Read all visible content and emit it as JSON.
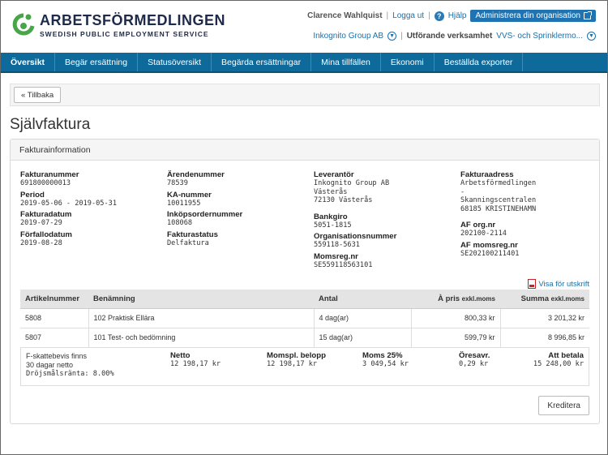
{
  "logo": {
    "title": "ARBETSFÖRMEDLINGEN",
    "subtitle": "SWEDISH PUBLIC EMPLOYMENT SERVICE",
    "icon": "af-logo-icon",
    "color": "#4aa54a"
  },
  "user": {
    "name": "Clarence Wahlquist",
    "separator": "|",
    "logout": "Logga ut",
    "help": "Hjälp",
    "help_icon": "?",
    "admin_button": "Administrera din organisation"
  },
  "org": {
    "name": "Inkognito Group AB",
    "separator": "|",
    "activity_label": "Utförande verksamhet",
    "activity_value": "VVS- och Sprinklermo..."
  },
  "nav": {
    "items": [
      "Översikt",
      "Begär ersättning",
      "Statusöversikt",
      "Begärda ersättningar",
      "Mina tillfällen",
      "Ekonomi",
      "Beställda exporter"
    ],
    "active": 0
  },
  "back_button": "« Tillbaka",
  "page_title": "Självfaktura",
  "panel_title": "Fakturainformation",
  "info": {
    "col1": [
      {
        "label": "Fakturanummer",
        "value": "691800000013"
      },
      {
        "label": "Period",
        "value": "2019-05-06 - 2019-05-31"
      },
      {
        "label": "Fakturadatum",
        "value": "2019-07-29"
      },
      {
        "label": "Förfallodatum",
        "value": "2019-08-28"
      }
    ],
    "col2": [
      {
        "label": "Ärendenummer",
        "value": "78539"
      },
      {
        "label": "KA-nummer",
        "value": "10011955"
      },
      {
        "label": "Inköpsordernummer",
        "value": "108068"
      },
      {
        "label": "Fakturastatus",
        "value": "Delfaktura"
      }
    ],
    "col3": {
      "leverantor_label": "Leverantör",
      "leverantor_lines": [
        "Inkognito Group AB",
        "Västerås",
        "72130 Västerås"
      ],
      "bankgiro_label": "Bankgiro",
      "bankgiro": "5051-1815",
      "orgnr_label": "Organisationsnummer",
      "orgnr": "559118-5631",
      "momsreg_label": "Momsreg.nr",
      "momsreg": "SE559118563101"
    },
    "col4": {
      "fakturaadress_label": "Fakturaadress",
      "fakturaadress_lines": [
        "Arbetsförmedlingen",
        "-",
        "Skanningscentralen",
        "68185 KRISTINEHAMN"
      ],
      "af_orgnr_label": "AF org.nr",
      "af_orgnr": "202100-2114",
      "af_momsreg_label": "AF momsreg.nr",
      "af_momsreg": "SE202100211401"
    }
  },
  "print_link": "Visa för utskrift",
  "table": {
    "headers": {
      "artikel": "Artikelnummer",
      "benamning": "Benämning",
      "antal": "Antal",
      "apris": "À pris",
      "apris_small": "exkl.moms",
      "summa": "Summa",
      "summa_small": "exkl.moms"
    },
    "rows": [
      {
        "artikel": "5808",
        "benamning": "102 Praktisk Ellära",
        "antal": "4 dag(ar)",
        "apris": "800,33 kr",
        "summa": "3 201,32 kr"
      },
      {
        "artikel": "5807",
        "benamning": "101 Test- och bedömning",
        "antal": "15 dag(ar)",
        "apris": "599,79 kr",
        "summa": "8 996,85 kr"
      }
    ]
  },
  "summary": {
    "fskatt": "F-skattebevis finns",
    "terms": "30 dagar netto",
    "interest": "Dröjsmålsränta: 8.00%",
    "netto_label": "Netto",
    "netto": "12 198,17 kr",
    "momspl_label": "Momspl. belopp",
    "momspl": "12 198,17 kr",
    "moms_label": "Moms 25%",
    "moms": "3 049,54 kr",
    "oresavr_label": "Öresavr.",
    "oresavr": "0,29 kr",
    "att_betala_label": "Att betala",
    "att_betala": "15 248,00 kr"
  },
  "credit_button": "Kreditera"
}
